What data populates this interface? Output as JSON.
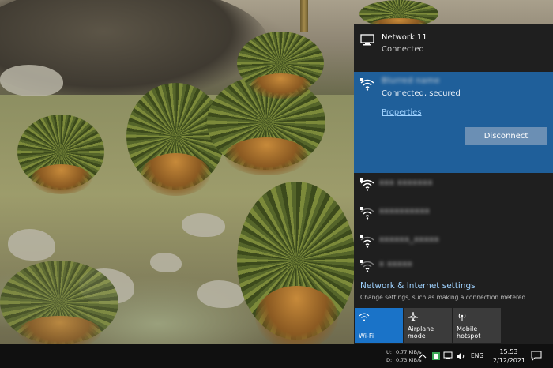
{
  "current_network": {
    "name": "Network 11",
    "status": "Connected"
  },
  "active_wifi": {
    "name_blurred": "Blurred name",
    "status": "Connected, secured",
    "properties_label": "Properties",
    "disconnect_label": "Disconnect"
  },
  "other_networks": [
    {
      "name_blurred": "xxx xxxxxxx"
    },
    {
      "name_blurred": "xxxxxxxxxx"
    },
    {
      "name_blurred": "xxxxxx_xxxxx"
    },
    {
      "name_blurred": "x xxxxx"
    }
  ],
  "settings": {
    "title": "Network & Internet settings",
    "subtitle": "Change settings, such as making a connection metered."
  },
  "quick_tiles": [
    {
      "label": "Wi-Fi",
      "icon": "wifi-icon",
      "active": true
    },
    {
      "label": "Airplane mode",
      "icon": "airplane-icon",
      "active": false
    },
    {
      "label": "Mobile hotspot",
      "icon": "hotspot-icon",
      "active": false
    }
  ],
  "taskbar": {
    "upload_label": "U:",
    "upload_value": "0.77 KiB/s",
    "download_label": "D:",
    "download_value": "0.73 KiB/s",
    "language": "ENG",
    "time": "15:53",
    "date": "2/12/2021"
  },
  "colors": {
    "flyout_bg": "#1f1f1f",
    "active_panel": "#1f5f9a",
    "accent_tile": "#1a73c8",
    "link": "#9fd2ff"
  }
}
